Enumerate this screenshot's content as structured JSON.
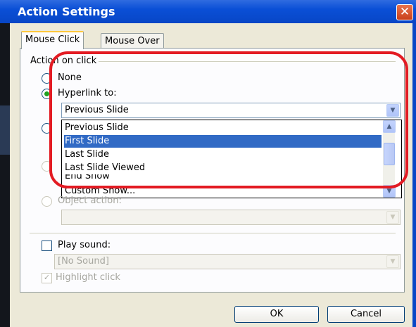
{
  "window": {
    "title": "Action Settings",
    "close_icon": "close-icon"
  },
  "tabs": [
    {
      "label": "Mouse Click"
    },
    {
      "label": "Mouse Over"
    }
  ],
  "group": {
    "label": "Action on click"
  },
  "options": {
    "none": "None",
    "hyperlink": "Hyperlink to:",
    "object_action": "Object action:"
  },
  "hyperlink_combo": {
    "value": "Previous Slide"
  },
  "dropdown_list": {
    "items": [
      "Previous Slide",
      "First Slide",
      "Last Slide",
      "Last Slide Viewed",
      "End Show",
      "Custom Show..."
    ],
    "selected_index": 1
  },
  "sound": {
    "label": "Play sound:",
    "value": "[No Sound]"
  },
  "highlight": {
    "label": "Highlight click"
  },
  "buttons": {
    "ok": "OK",
    "cancel": "Cancel"
  },
  "colors": {
    "titlebar": "#0a4fd6",
    "selection": "#316ac5",
    "annotation": "#e31b23"
  }
}
